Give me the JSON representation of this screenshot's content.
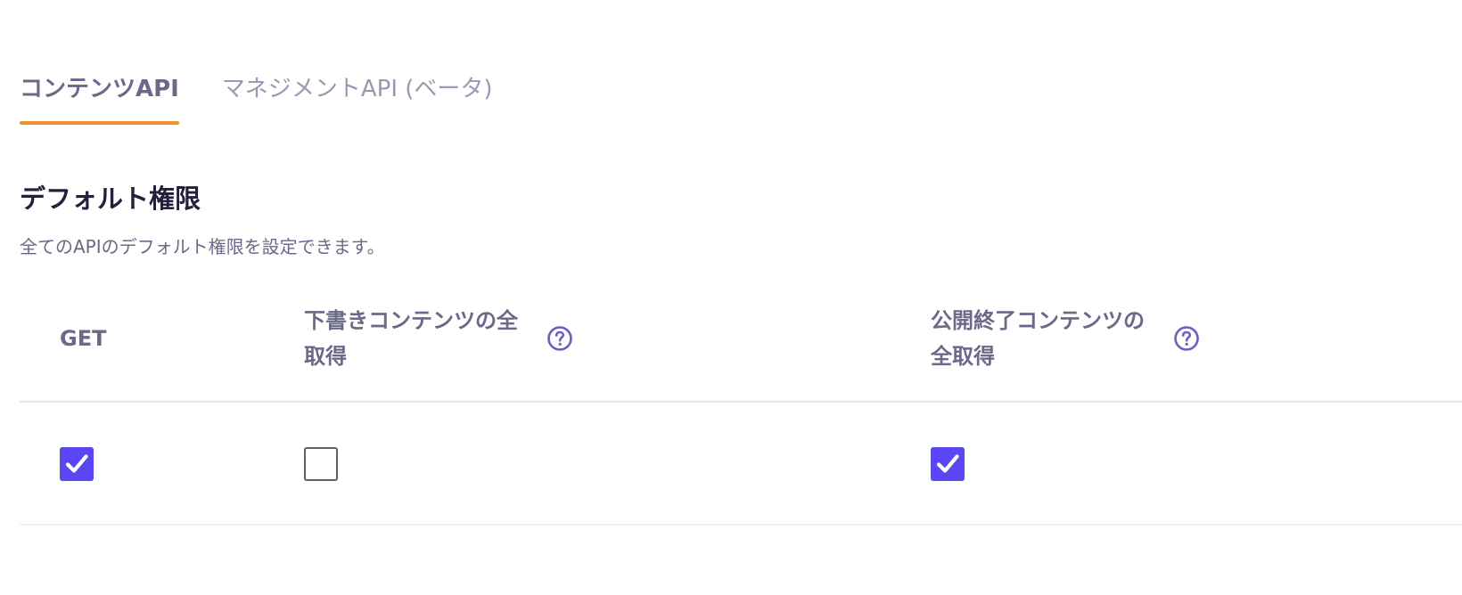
{
  "tabs": [
    {
      "label": "コンテンツAPI",
      "active": true
    },
    {
      "label": "マネジメントAPI (ベータ)",
      "active": false
    }
  ],
  "section": {
    "title": "デフォルト権限",
    "description": "全てのAPIのデフォルト権限を設定できます。"
  },
  "table": {
    "headers": {
      "get": "GET",
      "draft": "下書きコンテンツの全取得",
      "closed": "公開終了コンテンツの全取得"
    },
    "row": {
      "get": true,
      "draft": false,
      "closed": true
    }
  },
  "colors": {
    "accent": "#f3922b",
    "checkbox": "#5a45f7",
    "muted_text": "#6b6989"
  },
  "icons": {
    "help": "question-circle-icon",
    "check": "checkmark-icon"
  }
}
